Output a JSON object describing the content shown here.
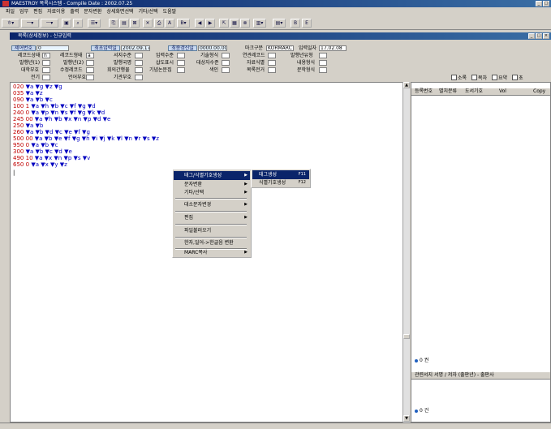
{
  "app": {
    "title": "MAESTROY 목록시스템 - Compile Date : 2002.07.25"
  },
  "menu": [
    "파일",
    "업무",
    "편집",
    "자료이용",
    "출력",
    "문자변환",
    "상세화면선택",
    "기타/선택",
    "도움말"
  ],
  "toolbar": {
    "combo1": "ㅎ",
    "combo2": "ㅡ",
    "combo3": "ㅡ",
    "btn_b": "B",
    "btn_e": "E"
  },
  "subwindow": {
    "title": "목록(상세정보) - 신규입력"
  },
  "form": {
    "row1": [
      {
        "label": "제어번호",
        "value": "0"
      },
      {
        "label": "최초입력일",
        "value": "2002.09.17"
      },
      {
        "label": "최종갱신일",
        "value": "0000.00.00"
      },
      {
        "label": "마크구분",
        "value": "KORMARC"
      },
      {
        "label": "입력일자",
        "value": "17.02.08"
      }
    ],
    "row2": [
      "레코드상태",
      "레코드형태",
      "서지수준",
      "입력수준",
      "기술형식",
      "연관레코드",
      "발행년유형"
    ],
    "row3": [
      "발행년(1)",
      "발행년(2)",
      "발행국명",
      "삽도표시",
      "대상자수준",
      "자료식별",
      "내용형식"
    ],
    "row4": [
      "대학부호",
      "수정레코드",
      "회의간행물",
      "기념논문집",
      "색인",
      "목록전거",
      "문학형식"
    ],
    "row5": [
      "전기",
      "언어부호",
      "기관부호"
    ],
    "values": {
      "rec_status": "n",
      "rec_type": "a"
    }
  },
  "marc_lines": [
    {
      "tag": "020",
      "ind": "",
      "content": "▼a ▼g ▼z ▼g"
    },
    {
      "tag": "035",
      "ind": "",
      "content": "▼a ▼z"
    },
    {
      "tag": "090",
      "ind": "",
      "content": "▼a ▼b ▼c"
    },
    {
      "tag": "100",
      "ind": "1",
      "content": "▼a ▼h ▼b ▼c ▼f ▼g ▼d"
    },
    {
      "tag": "240",
      "ind": "0",
      "content": "▼a ▼p ▼n ▼s ▼f ▼g ▼k ▼d"
    },
    {
      "tag": "245",
      "ind": "00",
      "content": "▼a ▼h ▼b ▼x ▼n ▼p ▼d ▼e"
    },
    {
      "tag": "250",
      "ind": "",
      "content": "▼a ▼b"
    },
    {
      "tag": "260",
      "ind": "",
      "content": "▼a ▼b ▼d ▼c ▼e ▼f ▼g"
    },
    {
      "tag": "500",
      "ind": "00",
      "content": "▼a ▼b ▼e ▼f ▼g ▼h ▼i ▼j ▼k ▼l ▼n ▼r ▼s ▼z"
    },
    {
      "tag": "950",
      "ind": "0",
      "content": "▼a ▼b ▼c"
    },
    {
      "tag": "300",
      "ind": "",
      "content": "▼a ▼b ▼c ▼d ▼e"
    },
    {
      "tag": "490",
      "ind": "10",
      "content": "▼a ▼x ▼n ▼p ▼s ▼v"
    },
    {
      "tag": "650",
      "ind": "0",
      "content": "▼a ▼x ▼y ▼z"
    }
  ],
  "context_menu": {
    "items": [
      {
        "label": "태그/식별기호생성",
        "arrow": "▶",
        "selected": true
      },
      {
        "label": "문자변환",
        "arrow": "▶"
      },
      {
        "label": "기타/선택",
        "arrow": "▶"
      },
      {
        "label": "대소문자변경",
        "arrow": "▶"
      },
      {
        "label": "편집",
        "arrow": "▶"
      },
      {
        "label": "파일불러오기",
        "arrow": ""
      },
      {
        "label": "한자,일어->한글음 변환",
        "arrow": ""
      },
      {
        "label": "MARC복사",
        "arrow": "▶"
      }
    ],
    "submenu": [
      {
        "label": "태그생성",
        "shortcut": "F11",
        "selected": true
      },
      {
        "label": "식별기호생성",
        "shortcut": "F12"
      }
    ]
  },
  "right_panel": {
    "checks": [
      "소록",
      "목차",
      "요약",
      "초"
    ],
    "holdings_header": [
      "등록번호",
      "별치분류",
      "도서기호",
      "Vol",
      "Copy"
    ],
    "holdings_count": "0 권",
    "related_header": "관련서지 서명 / 저자 (출판년) - 출판사",
    "related_count": "0 건"
  }
}
